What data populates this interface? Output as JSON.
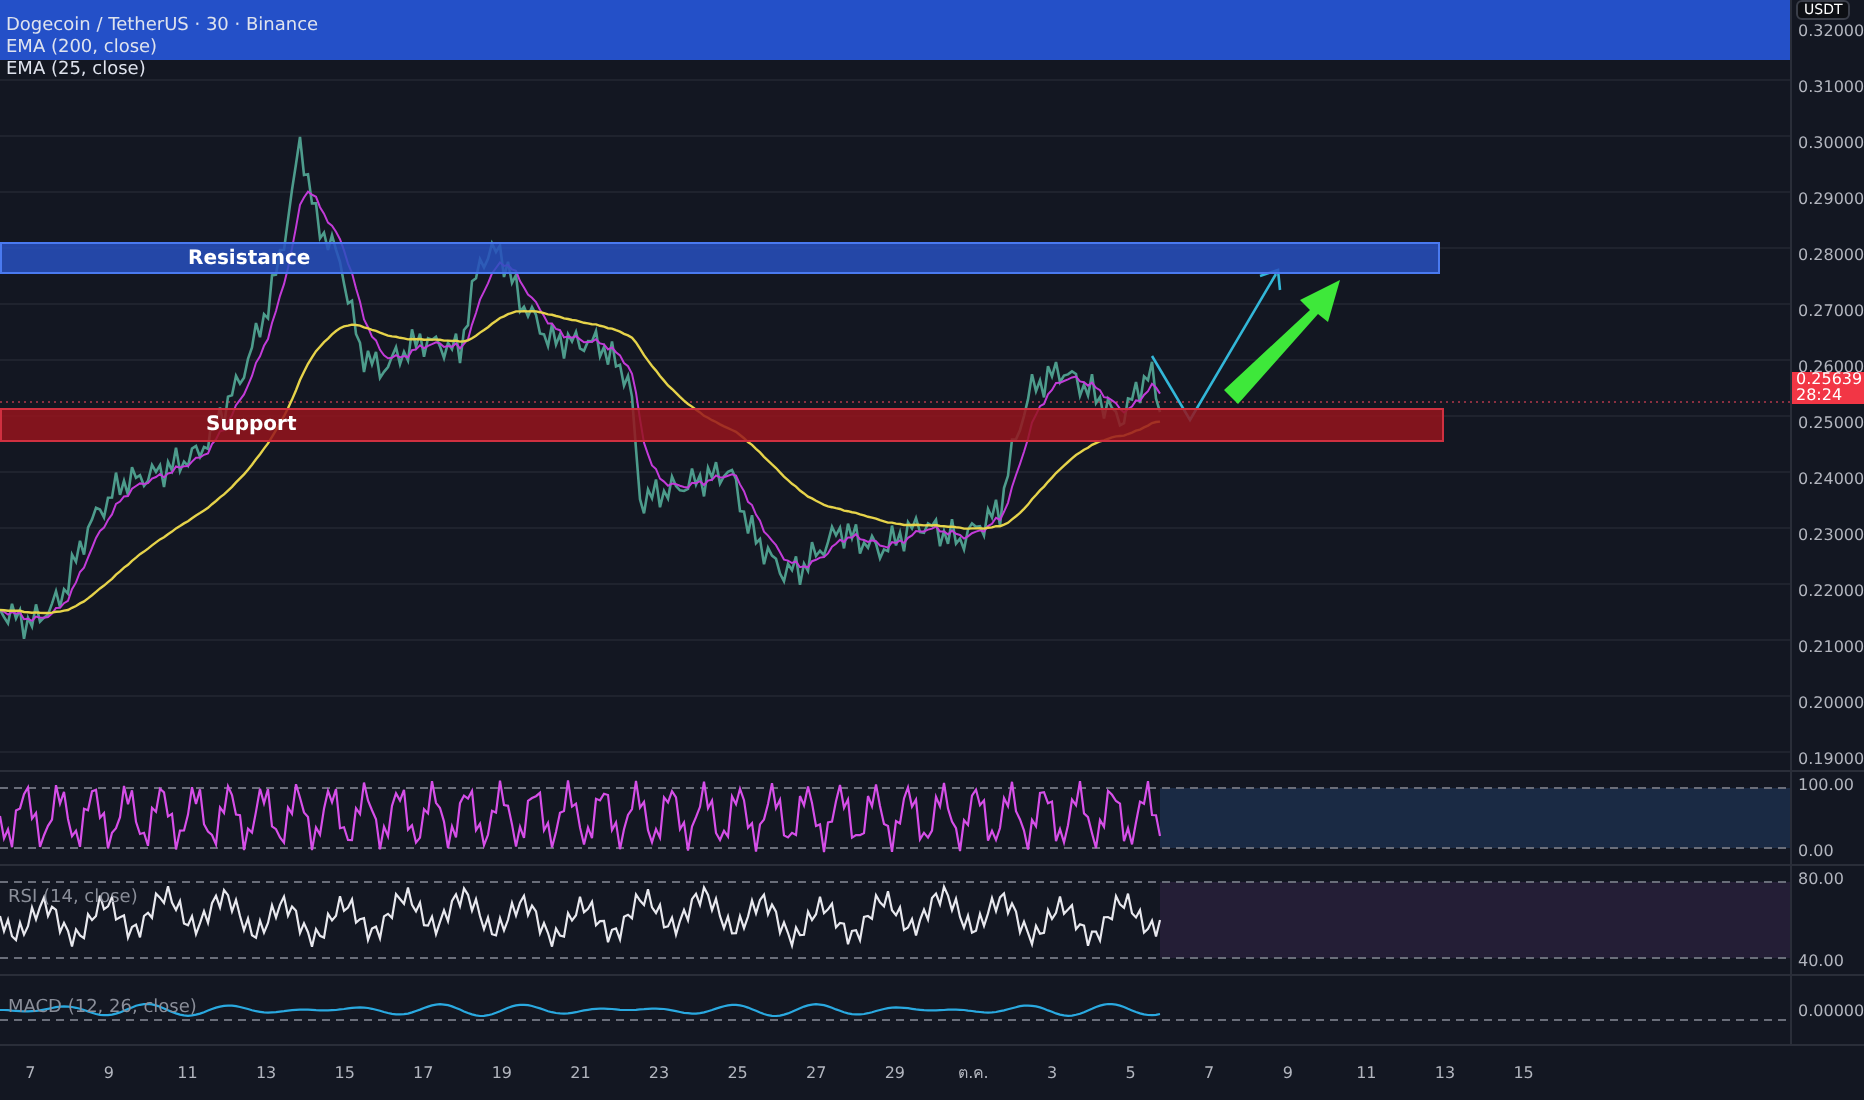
{
  "legend": {
    "symbol": "Dogecoin / TetherUS · 30 · Binance",
    "indicators": [
      "EMA (200, close)",
      "EMA (25, close)"
    ]
  },
  "currency_button": "USDT",
  "price_axis": [
    "0.32000",
    "0.31000",
    "0.30000",
    "0.29000",
    "0.28000",
    "0.27000",
    "0.26000",
    "0.25000",
    "0.24000",
    "0.23000",
    "0.22000",
    "0.21000",
    "0.20000",
    "0.19000"
  ],
  "last_price": {
    "value": "0.25639",
    "countdown": "28:24"
  },
  "zones": [
    {
      "kind": "resistance",
      "label": "Resistance"
    },
    {
      "kind": "support",
      "label": "Support"
    }
  ],
  "panes": [
    {
      "kind": "stoch",
      "axis": [
        "100.00",
        "0.00"
      ]
    },
    {
      "kind": "rsi",
      "label": "RSI (14, close)",
      "axis": [
        "80.00",
        "40.00"
      ]
    },
    {
      "kind": "macd",
      "label": "MACD (12, 26, close)",
      "axis": [
        "0.00000"
      ]
    }
  ],
  "time_axis": [
    "7",
    "9",
    "11",
    "13",
    "15",
    "17",
    "19",
    "21",
    "23",
    "25",
    "27",
    "29",
    "ต.ค.",
    "3",
    "5",
    "7",
    "9",
    "11",
    "13",
    "15"
  ]
}
